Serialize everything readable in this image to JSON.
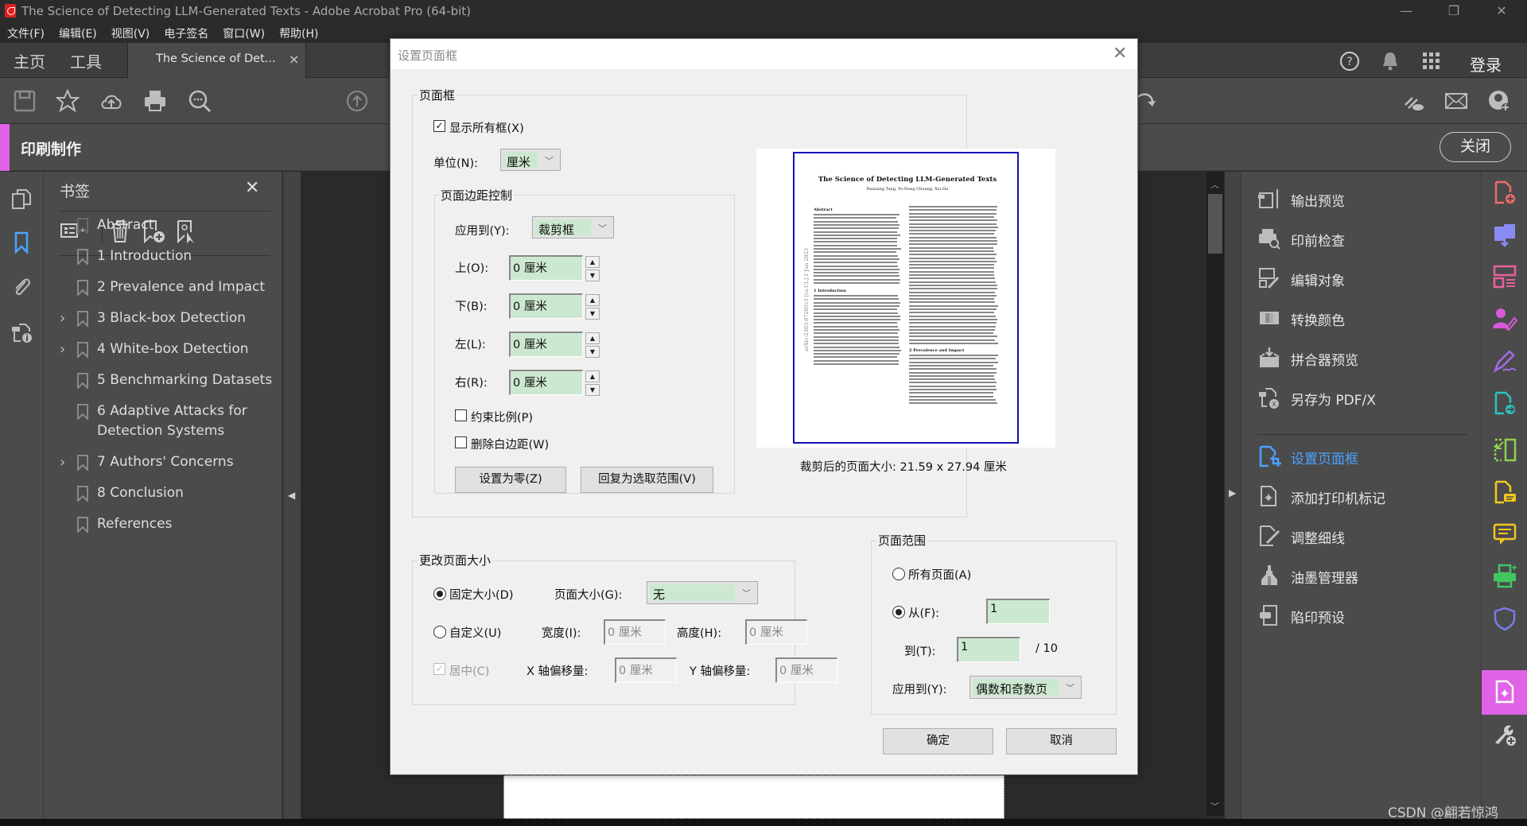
{
  "window": {
    "title": "The Science of Detecting LLM-Generated Texts - Adobe Acrobat Pro (64-bit)",
    "controls": [
      "minimize",
      "restore",
      "close"
    ]
  },
  "menubar": [
    "文件(F)",
    "编辑(E)",
    "视图(V)",
    "电子签名",
    "窗口(W)",
    "帮助(H)"
  ],
  "tabs": {
    "home": "主页",
    "tools": "工具",
    "document": "The Science of Det...",
    "close_symbol": "×"
  },
  "header_right": {
    "sign_in": "登录",
    "icons": [
      "help-icon",
      "bell-icon",
      "apps-grid-icon"
    ]
  },
  "toolbar": {
    "icons": [
      "save-icon",
      "star-icon",
      "cloud-upload-icon",
      "print-icon",
      "search-icon",
      "page-up-icon",
      "rotate-icon",
      "share-link-icon",
      "email-icon",
      "add-user-icon"
    ]
  },
  "tool_header": {
    "label": "印刷制作",
    "close_label": "关闭",
    "accent_color": "#e062e6"
  },
  "bookmarks": {
    "title": "书签",
    "items": [
      {
        "label": "Abstract",
        "expandable": false
      },
      {
        "label": "1 Introduction",
        "expandable": false
      },
      {
        "label": "2 Prevalence and Impact",
        "expandable": false
      },
      {
        "label": "3 Black-box Detection",
        "expandable": true
      },
      {
        "label": "4 White-box Detection",
        "expandable": true
      },
      {
        "label": "5 Benchmarking Datasets",
        "expandable": false
      },
      {
        "label": "6 Adaptive Attacks for Detection Systems",
        "expandable": false
      },
      {
        "label": "7 Authors' Concerns",
        "expandable": true
      },
      {
        "label": "8 Conclusion",
        "expandable": false
      },
      {
        "label": "References",
        "expandable": false
      }
    ]
  },
  "right_panel": {
    "items": [
      {
        "label": "输出预览",
        "icon": "output-preview-icon",
        "active": false
      },
      {
        "label": "印前检查",
        "icon": "preflight-icon",
        "active": false
      },
      {
        "label": "编辑对象",
        "icon": "edit-object-icon",
        "active": false
      },
      {
        "label": "转换颜色",
        "icon": "convert-colors-icon",
        "active": false
      },
      {
        "label": "拼合器预览",
        "icon": "flattener-preview-icon",
        "active": false
      },
      {
        "label": "另存为 PDF/X",
        "icon": "save-as-pdfx-icon",
        "active": false
      },
      {
        "label": "设置页面框",
        "icon": "set-page-boxes-icon",
        "active": true
      },
      {
        "label": "添加打印机标记",
        "icon": "printer-marks-icon",
        "active": false
      },
      {
        "label": "调整细线",
        "icon": "fix-hairlines-icon",
        "active": false
      },
      {
        "label": "油墨管理器",
        "icon": "ink-manager-icon",
        "active": false
      },
      {
        "label": "陷印预设",
        "icon": "trap-presets-icon",
        "active": false
      }
    ],
    "active_color": "#4aa3ff"
  },
  "right_rail": {
    "icons": [
      {
        "name": "create-pdf-icon",
        "color": "#f06a6a"
      },
      {
        "name": "export-pdf-icon",
        "color": "#8a8af5"
      },
      {
        "name": "organize-pages-icon",
        "color": "#e9609f"
      },
      {
        "name": "request-signature-icon",
        "color": "#d65ad9"
      },
      {
        "name": "fill-sign-icon",
        "color": "#a46be8"
      },
      {
        "name": "send-pdf-icon",
        "color": "#2ac3c3"
      },
      {
        "name": "compare-icon",
        "color": "#8fd14f"
      },
      {
        "name": "comment-file-icon",
        "color": "#f2c81d"
      },
      {
        "name": "comment-icon",
        "color": "#f2c81d"
      },
      {
        "name": "print-production-icon",
        "color": "#43c560"
      },
      {
        "name": "protect-icon",
        "color": "#7b7bf0"
      },
      {
        "name": "print-production-active-icon",
        "color": "#ffffff"
      },
      {
        "name": "add-tools-icon",
        "color": "#cfcfcf"
      }
    ]
  },
  "watermark": "CSDN @翩若惊鸿_",
  "dialog": {
    "title": "设置页面框",
    "page_boxes": {
      "legend": "页面框",
      "show_all_boxes_label": "显示所有框(X)",
      "show_all_boxes_checked": true,
      "units_label": "单位(N):",
      "units_value": "厘米",
      "margin_controls": {
        "legend": "页面边距控制",
        "apply_to_label": "应用到(Y):",
        "apply_to_value": "裁剪框",
        "top_label": "上(O):",
        "top_value": "0 厘米",
        "bottom_label": "下(B):",
        "bottom_value": "0 厘米",
        "left_label": "左(L):",
        "left_value": "0 厘米",
        "right_label": "右(R):",
        "right_value": "0 厘米",
        "constrain_label": "约束比例(P)",
        "constrain_checked": false,
        "remove_white_label": "删除白边距(W)",
        "remove_white_checked": false,
        "set_zero_button": "设置为零(Z)",
        "revert_button": "回复为选取范围(V)"
      },
      "preview": {
        "doc_title": "The Science of Detecting LLM-Generated Texts",
        "authors": "Ruixiang Tang, Yu-Neng Chuang, Xia Hu",
        "side_stamp": "arXiv:2303.07205v3 [cs.CL] 2 Jun 2023",
        "heading_abstract": "Abstract",
        "heading_intro": "1 Introduction",
        "heading_prevalence": "2 Prevalence and Impact",
        "cropped_size": "裁剪后的页面大小:  21.59 x 27.94 厘米",
        "box_color": "#1212b8"
      }
    },
    "change_page_size": {
      "legend": "更改页面大小",
      "fixed_size_label": "固定大小(D)",
      "fixed_size_selected": true,
      "page_size_label": "页面大小(G):",
      "page_size_value": "无",
      "custom_label": "自定义(U)",
      "custom_selected": false,
      "width_label": "宽度(I):",
      "width_value": "0 厘米",
      "height_label": "高度(H):",
      "height_value": "0 厘米",
      "center_label": "居中(C)",
      "center_checked": true,
      "x_offset_label": "X 轴偏移量:",
      "x_offset_value": "0 厘米",
      "y_offset_label": "Y 轴偏移量:",
      "y_offset_value": "0 厘米"
    },
    "page_range": {
      "legend": "页面范围",
      "all_pages_label": "所有页面(A)",
      "all_pages_selected": false,
      "from_label": "从(F):",
      "from_selected": true,
      "from_value": "1",
      "to_label": "到(T):",
      "to_value": "1",
      "total_pages": "/ 10",
      "apply_to_label": "应用到(Y):",
      "apply_to_value": "偶数和奇数页"
    },
    "ok_button": "确定",
    "cancel_button": "取消"
  }
}
